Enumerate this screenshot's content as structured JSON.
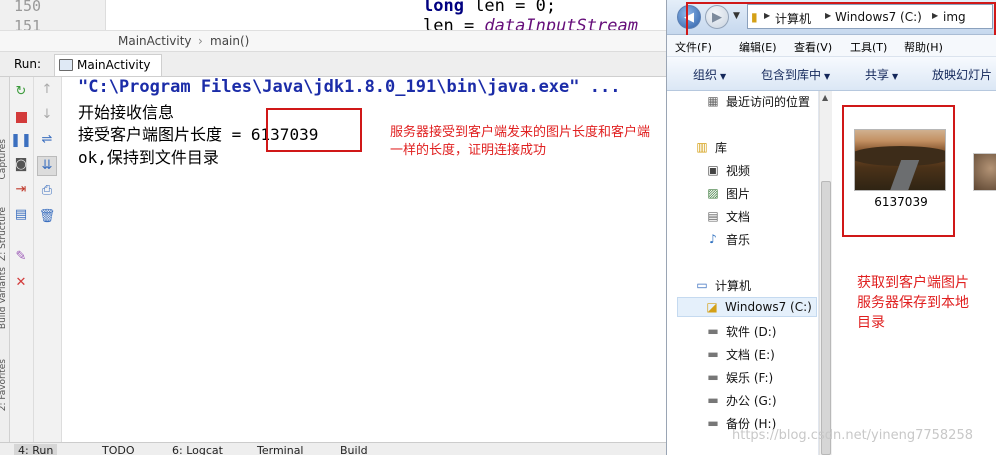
{
  "editor": {
    "line_numbers": [
      "150",
      "151"
    ],
    "code_line_1": {
      "keyword": "long",
      "rest": " len = 0;"
    },
    "code_line_2": {
      "var": "len = ",
      "call": "dataInputStream"
    }
  },
  "breadcrumb": {
    "items": [
      "MainActivity",
      "main()"
    ],
    "separator": "›"
  },
  "run_panel": {
    "label": "Run:",
    "tab_label": "MainActivity"
  },
  "left_vertical_tabs": [
    "Captures",
    "Z: Structure",
    "Build Variants",
    "2: Favorites"
  ],
  "console": {
    "command": "\"C:\\Program Files\\Java\\jdk1.8.0_191\\bin\\java.exe\" ...",
    "line1": "开始接收信息",
    "line2_prefix": "接受客户端图片长度 = ",
    "line2_value": "6137039",
    "line3": "ok,保持到文件目录"
  },
  "annotation_left": {
    "line1": "服务器接受到客户端发来的图片长度和客户端",
    "line2": "一样的长度，证明连接成功"
  },
  "bottom_tabs": [
    "4: Run",
    "TODO",
    "6: Logcat",
    "Terminal",
    "Build"
  ],
  "explorer": {
    "address": [
      "计算机",
      "Windows7 (C:)",
      "img"
    ],
    "menu": [
      "文件(F)",
      "编辑(E)",
      "查看(V)",
      "工具(T)",
      "帮助(H)"
    ],
    "commands": [
      "组织",
      "包含到库中",
      "共享",
      "放映幻灯片"
    ],
    "nav": {
      "recent": "最近访问的位置",
      "libraries": "库",
      "videos": "视频",
      "pictures": "图片",
      "documents": "文档",
      "music": "音乐",
      "computer": "计算机",
      "drive_c": "Windows7 (C:)",
      "drive_d": "软件 (D:)",
      "drive_e": "文档 (E:)",
      "drive_f": "娱乐 (F:)",
      "drive_g": "办公 (G:)",
      "drive_h": "备份 (H:)"
    },
    "file_name": "6137039",
    "annotation": {
      "line1": "获取到客户端图片",
      "line2": "服务器保存到本地",
      "line3": "目录"
    }
  },
  "watermark": "https://blog.csdn.net/yineng7758258",
  "colors": {
    "annotation_red": "#e02020",
    "box_red": "#d01818",
    "console_path_blue": "#1b2ca8"
  }
}
